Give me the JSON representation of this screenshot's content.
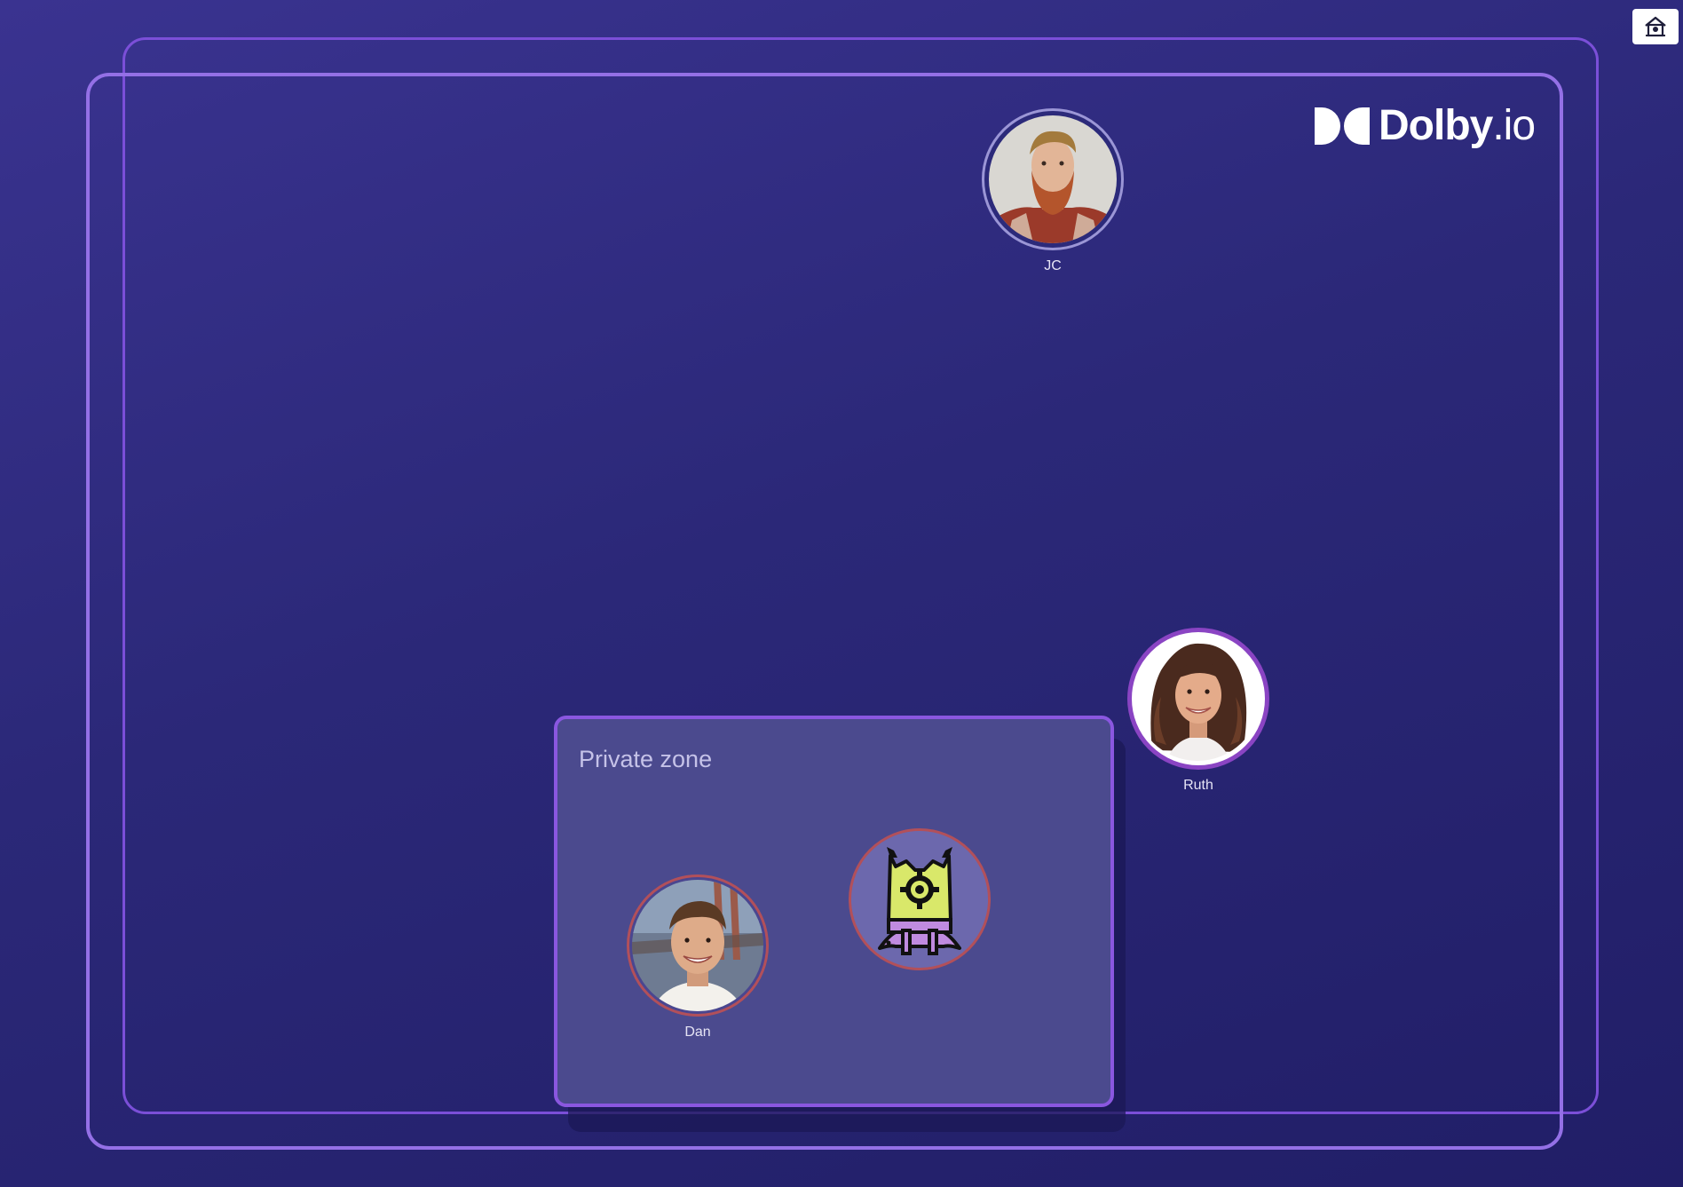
{
  "toolbar": {
    "home_icon": "home-icon"
  },
  "logo": {
    "brand": "Dolby",
    "suffix": ".io",
    "color": "#ffffff"
  },
  "colors": {
    "background": "#2b2878",
    "frame_border": "#7b4fd8",
    "zone_fill": "#4b4a8e",
    "zone_border": "#8a57e0"
  },
  "participants": [
    {
      "name": "JC",
      "avatar": "bearded-man-photo"
    },
    {
      "name": "Ruth",
      "avatar": "curly-haired-woman-photo"
    },
    {
      "name": "Dan",
      "avatar": "smiling-man-photo"
    },
    {
      "name": "",
      "avatar": "robot-mascot-icon"
    }
  ],
  "private_zone": {
    "title": "Private zone"
  }
}
